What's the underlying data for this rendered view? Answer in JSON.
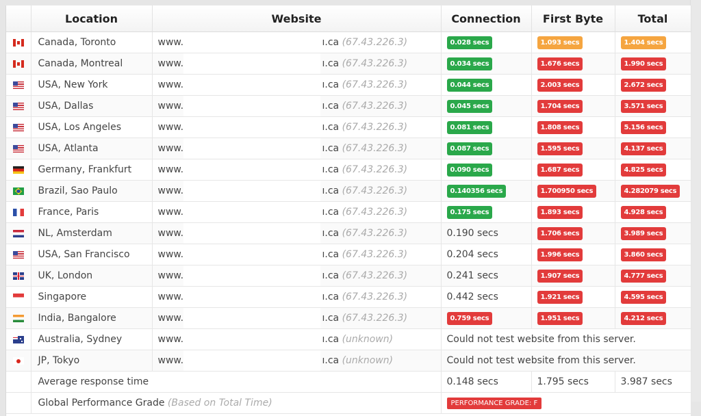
{
  "headers": {
    "flag": "",
    "location": "Location",
    "website": "Website",
    "connection": "Connection",
    "first_byte": "First Byte",
    "total": "Total"
  },
  "colors": {
    "good": "#2aa84a",
    "warn": "#f5a540",
    "bad": "#e23b3b"
  },
  "rows": [
    {
      "flag": "canada-flag-icon",
      "location": "Canada, Toronto",
      "site_prefix": "www.",
      "site_suffix": "ı.ca",
      "ip": "(67.43.226.3)",
      "connection": {
        "text": "0.028 secs",
        "style": "g"
      },
      "first_byte": {
        "text": "1.093 secs",
        "style": "o"
      },
      "total": {
        "text": "1.404 secs",
        "style": "o"
      }
    },
    {
      "flag": "canada-flag-icon",
      "location": "Canada, Montreal",
      "site_prefix": "www.",
      "site_suffix": "ı.ca",
      "ip": "(67.43.226.3)",
      "connection": {
        "text": "0.034 secs",
        "style": "g"
      },
      "first_byte": {
        "text": "1.676 secs",
        "style": "r"
      },
      "total": {
        "text": "1.990 secs",
        "style": "r"
      }
    },
    {
      "flag": "usa-flag-icon",
      "location": "USA, New York",
      "site_prefix": "www.",
      "site_suffix": "ı.ca",
      "ip": "(67.43.226.3)",
      "connection": {
        "text": "0.044 secs",
        "style": "g"
      },
      "first_byte": {
        "text": "2.003 secs",
        "style": "r"
      },
      "total": {
        "text": "2.672 secs",
        "style": "r"
      }
    },
    {
      "flag": "usa-flag-icon",
      "location": "USA, Dallas",
      "site_prefix": "www.",
      "site_suffix": "ı.ca",
      "ip": "(67.43.226.3)",
      "connection": {
        "text": "0.045 secs",
        "style": "g"
      },
      "first_byte": {
        "text": "1.704 secs",
        "style": "r"
      },
      "total": {
        "text": "3.571 secs",
        "style": "r"
      }
    },
    {
      "flag": "usa-flag-icon",
      "location": "USA, Los Angeles",
      "site_prefix": "www.",
      "site_suffix": "ı.ca",
      "ip": "(67.43.226.3)",
      "connection": {
        "text": "0.081 secs",
        "style": "g"
      },
      "first_byte": {
        "text": "1.808 secs",
        "style": "r"
      },
      "total": {
        "text": "5.156 secs",
        "style": "r"
      }
    },
    {
      "flag": "usa-flag-icon",
      "location": "USA, Atlanta",
      "site_prefix": "www.",
      "site_suffix": "ı.ca",
      "ip": "(67.43.226.3)",
      "connection": {
        "text": "0.087 secs",
        "style": "g"
      },
      "first_byte": {
        "text": "1.595 secs",
        "style": "r"
      },
      "total": {
        "text": "4.137 secs",
        "style": "r"
      }
    },
    {
      "flag": "germany-flag-icon",
      "location": "Germany, Frankfurt",
      "site_prefix": "www.",
      "site_suffix": "ı.ca",
      "ip": "(67.43.226.3)",
      "connection": {
        "text": "0.090 secs",
        "style": "g"
      },
      "first_byte": {
        "text": "1.687 secs",
        "style": "r"
      },
      "total": {
        "text": "4.825 secs",
        "style": "r"
      }
    },
    {
      "flag": "brazil-flag-icon",
      "location": "Brazil, Sao Paulo",
      "site_prefix": "www.",
      "site_suffix": "ı.ca",
      "ip": "(67.43.226.3)",
      "connection": {
        "text": "0.140356 secs",
        "style": "g"
      },
      "first_byte": {
        "text": "1.700950 secs",
        "style": "r"
      },
      "total": {
        "text": "4.282079 secs",
        "style": "r"
      }
    },
    {
      "flag": "france-flag-icon",
      "location": "France, Paris",
      "site_prefix": "www.",
      "site_suffix": "ı.ca",
      "ip": "(67.43.226.3)",
      "connection": {
        "text": "0.175 secs",
        "style": "g"
      },
      "first_byte": {
        "text": "1.893 secs",
        "style": "r"
      },
      "total": {
        "text": "4.928 secs",
        "style": "r"
      }
    },
    {
      "flag": "netherlands-flag-icon",
      "location": "NL, Amsterdam",
      "site_prefix": "www.",
      "site_suffix": "ı.ca",
      "ip": "(67.43.226.3)",
      "connection": {
        "text": "0.190 secs",
        "style": ""
      },
      "first_byte": {
        "text": "1.706 secs",
        "style": "r"
      },
      "total": {
        "text": "3.989 secs",
        "style": "r"
      }
    },
    {
      "flag": "usa-flag-icon",
      "location": "USA, San Francisco",
      "site_prefix": "www.",
      "site_suffix": "ı.ca",
      "ip": "(67.43.226.3)",
      "connection": {
        "text": "0.204 secs",
        "style": ""
      },
      "first_byte": {
        "text": "1.996 secs",
        "style": "r"
      },
      "total": {
        "text": "3.860 secs",
        "style": "r"
      }
    },
    {
      "flag": "uk-flag-icon",
      "location": "UK, London",
      "site_prefix": "www.",
      "site_suffix": "ı.ca",
      "ip": "(67.43.226.3)",
      "connection": {
        "text": "0.241 secs",
        "style": ""
      },
      "first_byte": {
        "text": "1.907 secs",
        "style": "r"
      },
      "total": {
        "text": "4.777 secs",
        "style": "r"
      }
    },
    {
      "flag": "singapore-flag-icon",
      "location": "Singapore",
      "site_prefix": "www.",
      "site_suffix": "ı.ca",
      "ip": "(67.43.226.3)",
      "connection": {
        "text": "0.442 secs",
        "style": ""
      },
      "first_byte": {
        "text": "1.921 secs",
        "style": "r"
      },
      "total": {
        "text": "4.595 secs",
        "style": "r"
      }
    },
    {
      "flag": "india-flag-icon",
      "location": "India, Bangalore",
      "site_prefix": "www.",
      "site_suffix": "ı.ca",
      "ip": "(67.43.226.3)",
      "connection": {
        "text": "0.759 secs",
        "style": "r"
      },
      "first_byte": {
        "text": "1.951 secs",
        "style": "r"
      },
      "total": {
        "text": "4.212 secs",
        "style": "r"
      }
    },
    {
      "flag": "australia-flag-icon",
      "location": "Australia, Sydney",
      "site_prefix": "www.",
      "site_suffix": "ı.ca",
      "ip": "(unknown)",
      "error": "Could not test website from this server."
    },
    {
      "flag": "japan-flag-icon",
      "location": "JP, Tokyo",
      "site_prefix": "www.",
      "site_suffix": "ı.ca",
      "ip": "(unknown)",
      "error": "Could not test website from this server."
    }
  ],
  "average": {
    "label": "Average response time",
    "connection": "0.148 secs",
    "first_byte": "1.795 secs",
    "total": "3.987 secs"
  },
  "grade": {
    "label": "Global Performance Grade",
    "note": "(Based on Total Time)",
    "badge": "PERFORMANCE GRADE: F"
  }
}
